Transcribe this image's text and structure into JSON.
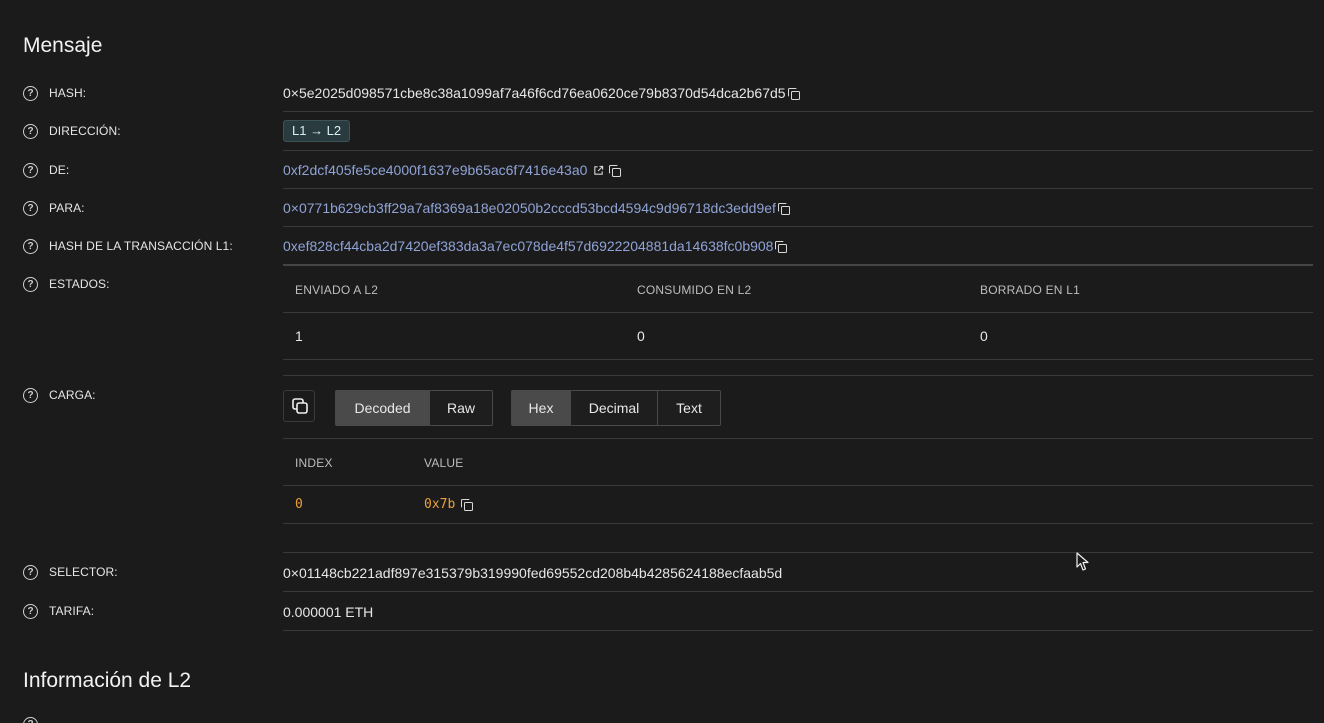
{
  "message_section": {
    "title": "Mensaje",
    "rows": {
      "hash": {
        "label": "HASH:",
        "value": "0×5e2025d098571cbe8c38a1099af7a46f6cd76ea0620ce79b8370d54dca2b67d5"
      },
      "direction": {
        "label": "DIRECCIÓN:",
        "value": "L1 → L2"
      },
      "from": {
        "label": "DE:",
        "value": "0xf2dcf405fe5ce4000f1637e9b65ac6f7416e43a0"
      },
      "to": {
        "label": "PARA:",
        "value": "0×0771b629cb3ff29a7af8369a18e02050b2cccd53bcd4594c9d96718dc3edd9ef"
      },
      "l1_tx_hash": {
        "label": "HASH DE LA TRANSACCIÓN L1:",
        "value": "0xef828cf44cba2d7420ef383da3a7ec078de4f57d6922204881da14638fc0b908"
      },
      "states": {
        "label": "ESTADOS:",
        "headers": [
          "ENVIADO A L2",
          "CONSUMIDO EN L2",
          "BORRADO EN L1"
        ],
        "values": [
          "1",
          "0",
          "0"
        ]
      },
      "payload": {
        "label": "CARGA:",
        "view_buttons": [
          "Decoded",
          "Raw"
        ],
        "view_active": "Decoded",
        "format_buttons": [
          "Hex",
          "Decimal",
          "Text"
        ],
        "format_active": "Hex",
        "table_headers": [
          "INDEX",
          "VALUE"
        ],
        "rows": [
          {
            "index": "0",
            "value": "0x7b"
          }
        ]
      },
      "selector": {
        "label": "SELECTOR:",
        "value": "0×01148cb221adf897e315379b319990fed69552cd208b4b4285624188ecfaab5d"
      },
      "fee": {
        "label": "TARIFA:",
        "value": "0.000001 ETH"
      }
    }
  },
  "l2_section": {
    "title": "Información de L2"
  },
  "colors": {
    "background": "#1b1b1b",
    "link": "#8fa3d6",
    "badge_bg": "#2a3b3f",
    "mono_value": "#e9a23b",
    "active_button": "#4a4a4a"
  },
  "icons": [
    "help-icon",
    "copy-icon",
    "external-link-icon",
    "mouse-cursor-icon"
  ]
}
